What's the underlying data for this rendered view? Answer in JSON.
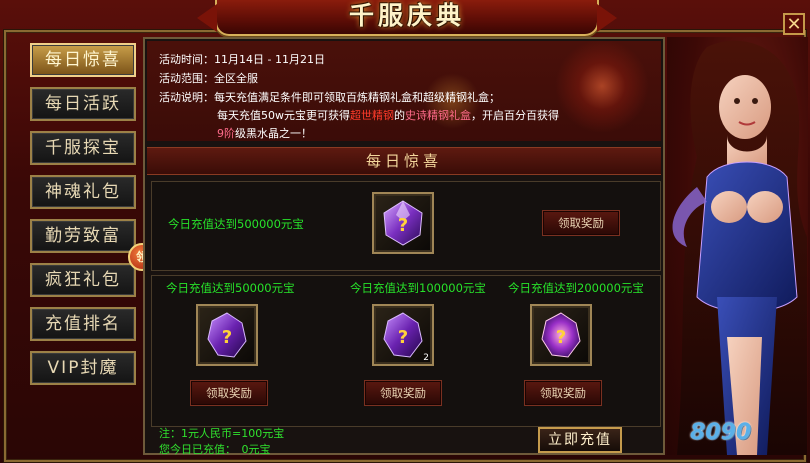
{
  "window": {
    "title": "千服庆典",
    "close_label": "✕"
  },
  "tabs": [
    {
      "label": "每日惊喜",
      "active": true
    },
    {
      "label": "每日活跃",
      "active": false
    },
    {
      "label": "千服探宝",
      "active": false
    },
    {
      "label": "神魂礼包",
      "active": false
    },
    {
      "label": "勤劳致富",
      "active": false
    },
    {
      "label": "疯狂礼包",
      "active": false
    },
    {
      "label": "充值排名",
      "active": false
    },
    {
      "label": "VIP封魔",
      "active": false
    }
  ],
  "badge": "领",
  "info": {
    "time_label": "活动时间：",
    "time_value": "11月14日 - 11月21日",
    "scope_label": "活动范围：",
    "scope_value": "全区全服",
    "desc_label": "活动说明：",
    "desc_line1": "每天充值满足条件即可领取百炼精钢礼盒和超级精钢礼盒；",
    "desc_line2_a": "每天充值50w元宝更可获得",
    "desc_line2_b": "超世精钢",
    "desc_line2_c": "的",
    "desc_line2_d": "史诗精钢礼盒",
    "desc_line2_e": "，开启百分百获得",
    "desc_line3_a": "9阶",
    "desc_line3_b": "级黑水晶之一！"
  },
  "section_title": "每日惊喜",
  "top_reward": {
    "condition": "今日充值达到500000元宝",
    "button": "领取奖励"
  },
  "rewards": [
    {
      "condition": "今日充值达到50000元宝",
      "button": "领取奖励",
      "qty": ""
    },
    {
      "condition": "今日充值达到100000元宝",
      "button": "领取奖励",
      "qty": "2"
    },
    {
      "condition": "今日充值达到200000元宝",
      "button": "领取奖励",
      "qty": ""
    }
  ],
  "footer": {
    "note": "注：1元人民币=100元宝",
    "today": "您今日已充值：　0元宝",
    "recharge_button": "立即充值"
  },
  "logo_text": "8090"
}
